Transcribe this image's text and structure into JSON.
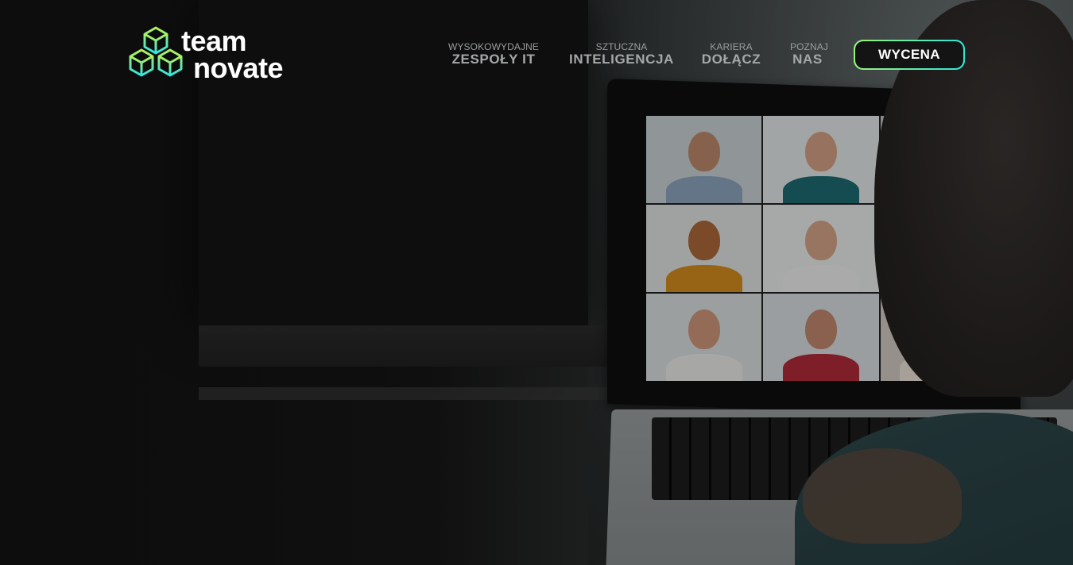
{
  "brand": {
    "name_line1": "team",
    "name_line2": "novate",
    "logo_icon": "cubes-logo-icon",
    "gradient_start": "#b6f35a",
    "gradient_end": "#2fe5e0"
  },
  "nav": {
    "items": [
      {
        "small": "WYSOKOWYDAJNE",
        "big": "ZESPOŁY IT"
      },
      {
        "small": "SZTUCZNA",
        "big": "INTELIGENCJA"
      },
      {
        "small": "KARIERA",
        "big": "DOŁĄCZ"
      },
      {
        "small": "POZNAJ",
        "big": "NAS"
      }
    ],
    "cta_label": "WYCENA",
    "cta_border_color": "#3ff0c2"
  },
  "hero_image": "person-on-video-call-laptop"
}
